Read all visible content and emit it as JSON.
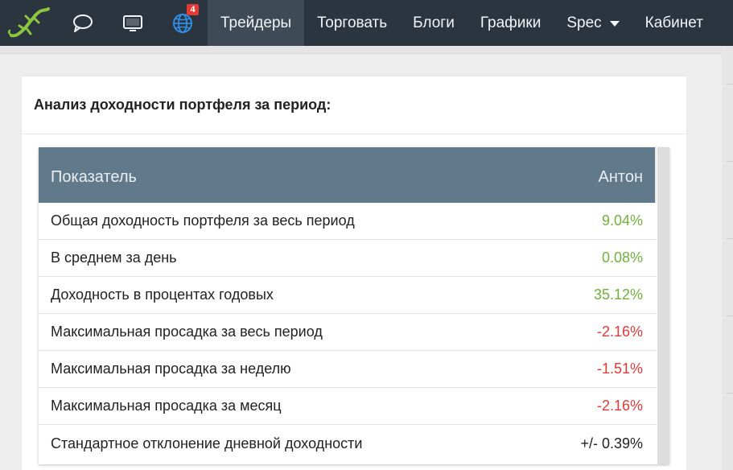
{
  "nav": {
    "badge_count": "4",
    "items": [
      {
        "label": "Трейдеры",
        "active": true
      },
      {
        "label": "Торговать",
        "active": false
      },
      {
        "label": "Блоги",
        "active": false
      },
      {
        "label": "Графики",
        "active": false
      },
      {
        "label": "Spec",
        "active": false
      },
      {
        "label": "Кабинет",
        "active": false
      }
    ],
    "icons": [
      "lizard-logo",
      "chat-bubble-icon",
      "monitor-icon",
      "globe-icon"
    ]
  },
  "card": {
    "title": "Анализ доходности портфеля за период:"
  },
  "table": {
    "headers": [
      "Показатель",
      "Антон"
    ],
    "rows": [
      {
        "label": "Общая доходность портфеля за весь период",
        "value": "9.04%",
        "status": "positive"
      },
      {
        "label": "В среднем за день",
        "value": "0.08%",
        "status": "positive"
      },
      {
        "label": "Доходность в процентах годовых",
        "value": "35.12%",
        "status": "positive"
      },
      {
        "label": "Максимальная просадка за весь период",
        "value": "-2.16%",
        "status": "negative"
      },
      {
        "label": "Максимальная просадка за неделю",
        "value": "-1.51%",
        "status": "negative"
      },
      {
        "label": "Максимальная просадка за месяц",
        "value": "-2.16%",
        "status": "negative"
      },
      {
        "label": "Стандартное отклонение дневной доходности",
        "value": "+/- 0.39%",
        "status": "neutral"
      }
    ]
  },
  "colors": {
    "navbar": "#2b3540",
    "header": "#607a8b",
    "positive": "#6fb33a",
    "negative": "#e53935",
    "neutral": "#222222"
  }
}
